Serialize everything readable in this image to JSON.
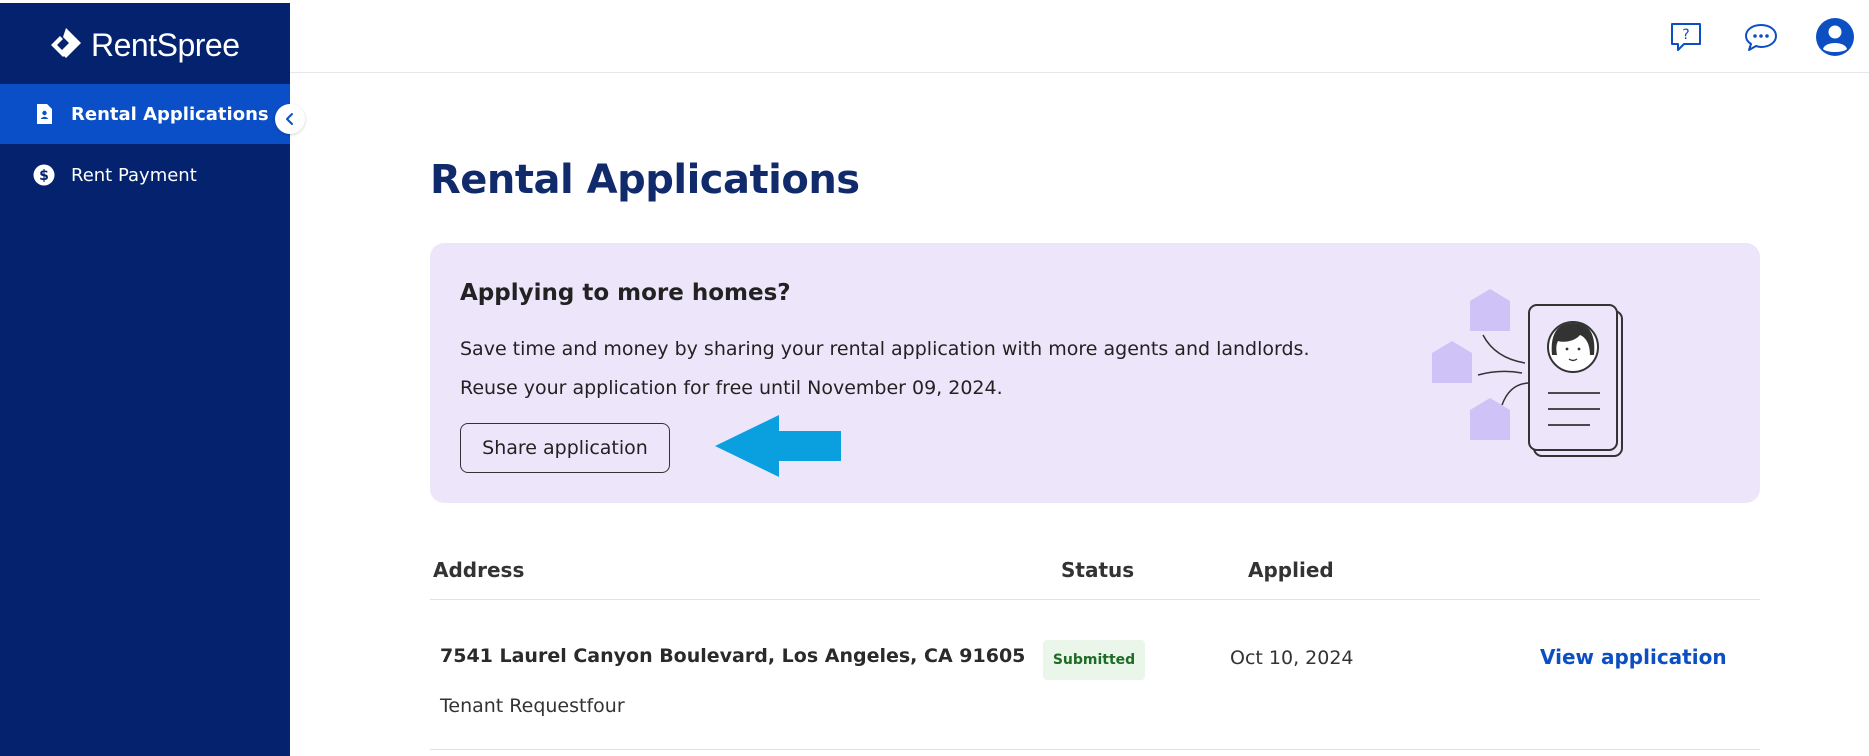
{
  "brand": {
    "logo_text": "RentSpree"
  },
  "sidebar": {
    "items": [
      {
        "label": "Rental Applications",
        "icon": "document-icon",
        "active": true
      },
      {
        "label": "Rent Payment",
        "icon": "dollar-circle-icon",
        "active": false
      }
    ]
  },
  "topbar": {
    "icons": [
      "help-icon",
      "chat-icon",
      "profile-icon"
    ]
  },
  "main": {
    "title": "Rental Applications",
    "banner": {
      "title": "Applying to more homes?",
      "line1": "Save time and money by sharing your rental application with more agents and landlords.",
      "line2": "Reuse your application for free until November 09, 2024.",
      "button_label": "Share application"
    },
    "table": {
      "headers": {
        "address": "Address",
        "status": "Status",
        "applied": "Applied"
      },
      "rows": [
        {
          "address": "7541 Laurel Canyon Boulevard, Los Angeles, CA 91605",
          "name": "Tenant Requestfour",
          "status": "Submitted",
          "applied": "Oct 10, 2024",
          "action": "View application"
        }
      ]
    }
  },
  "colors": {
    "sidebar_bg": "#04226d",
    "sidebar_active": "#0a4fc7",
    "title": "#102a6b",
    "banner_bg": "#ede6fb",
    "link": "#0b4fc3",
    "badge_bg": "#eaf6ea",
    "badge_text": "#1e6b24",
    "arrow": "#0aa0e0"
  }
}
